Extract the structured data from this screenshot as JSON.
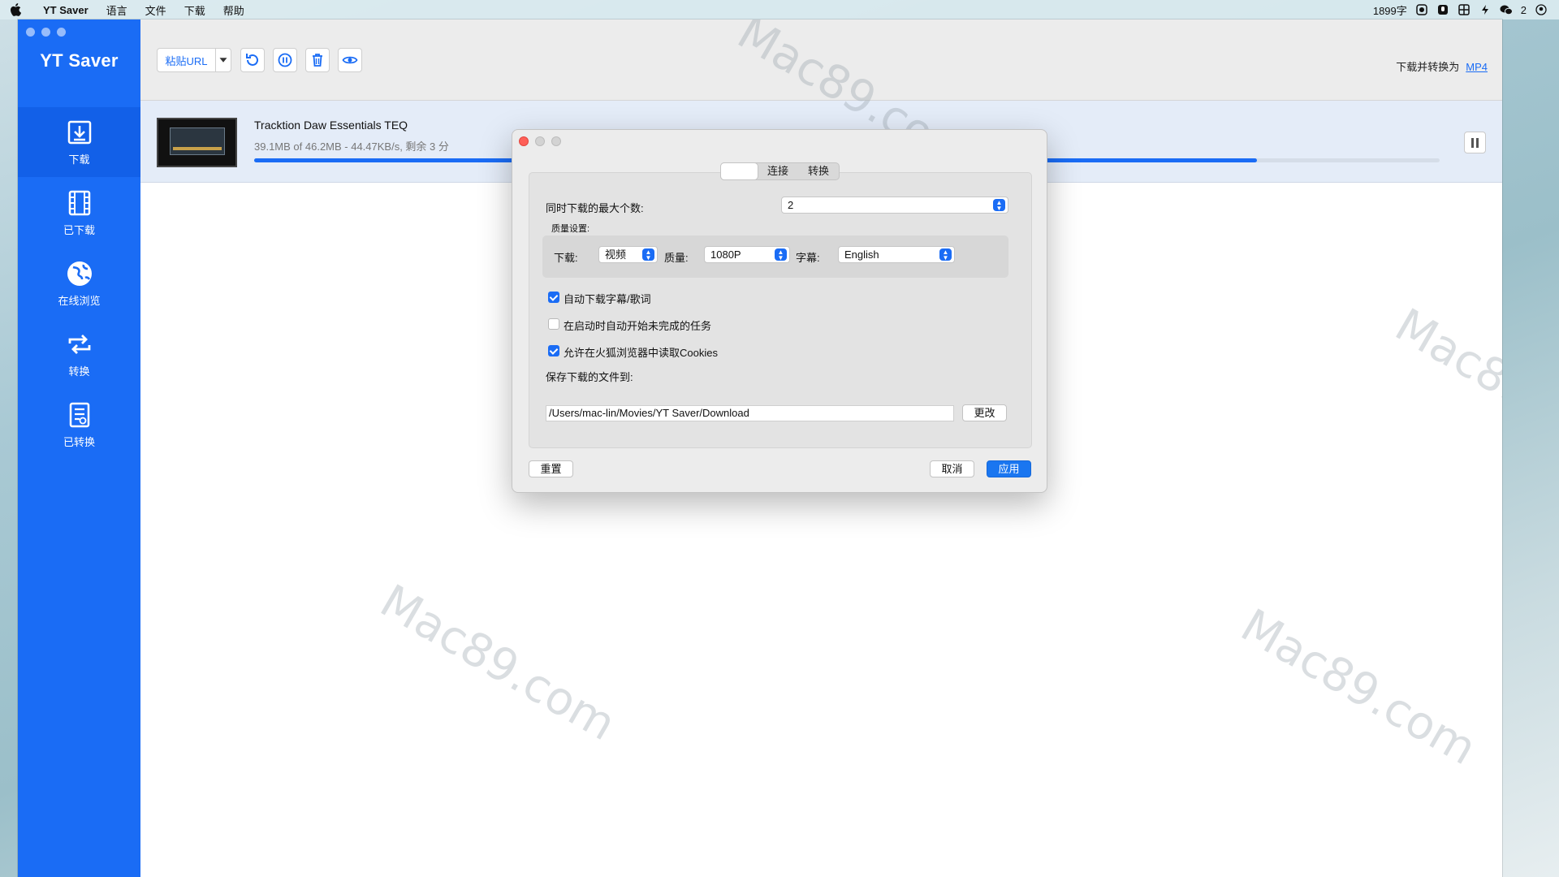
{
  "menubar": {
    "app_name": "YT Saver",
    "menus": [
      "语言",
      "文件",
      "下载",
      "帮助"
    ],
    "word_count": "1899字",
    "wechat_count": "2"
  },
  "sidebar": {
    "logo": "YT Saver",
    "items": [
      {
        "label": "下载",
        "icon": "download-icon"
      },
      {
        "label": "已下载",
        "icon": "film-icon"
      },
      {
        "label": "在线浏览",
        "icon": "globe-icon"
      },
      {
        "label": "转换",
        "icon": "convert-icon"
      },
      {
        "label": "已转换",
        "icon": "converted-list-icon"
      }
    ]
  },
  "toolbar": {
    "paste_url_label": "粘贴URL",
    "convert_label": "下载并转换为",
    "convert_format": "MP4"
  },
  "download": {
    "title": "Tracktion Daw Essentials TEQ",
    "stats": "39.1MB of 46.2MB - 44.47KB/s, 剩余 3 分",
    "progress": 0.846
  },
  "dialog": {
    "tabs": [
      "",
      "连接",
      "转换"
    ],
    "max_downloads_label": "同时下载的最大个数:",
    "max_downloads_value": "2",
    "quality_section_label": "质量设置:",
    "download_label": "下载:",
    "download_value": "视频",
    "quality_label": "质量:",
    "quality_value": "1080P",
    "subtitle_label": "字幕:",
    "subtitle_value": "English",
    "options": [
      {
        "label": "自动下载字幕/歌词",
        "checked": true
      },
      {
        "label": "在启动时自动开始未完成的任务",
        "checked": false
      },
      {
        "label": "允许在火狐浏览器中读取Cookies",
        "checked": true
      }
    ],
    "save_to_label": "保存下载的文件到:",
    "save_path": "/Users/mac-lin/Movies/YT Saver/Download",
    "change_button": "更改",
    "reset_button": "重置",
    "cancel_button": "取消",
    "apply_button": "应用"
  },
  "watermark": "Mac89.com"
}
